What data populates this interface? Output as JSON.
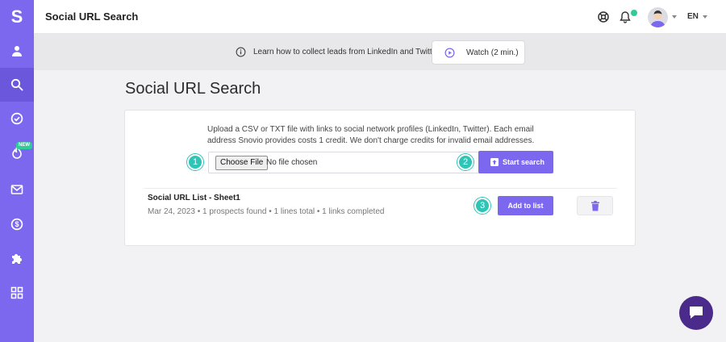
{
  "app": {
    "logo_letter": "S",
    "title": "Social URL Search"
  },
  "sidebar": {
    "items": [
      {
        "icon": "user-icon"
      },
      {
        "icon": "search-icon",
        "active": true
      },
      {
        "icon": "check-circle-icon"
      },
      {
        "icon": "fire-icon",
        "badge": "NEW"
      },
      {
        "icon": "mail-icon"
      },
      {
        "icon": "dollar-icon"
      },
      {
        "icon": "puzzle-icon"
      },
      {
        "icon": "apps-grid-icon"
      }
    ]
  },
  "header": {
    "help_icon": "lifebuoy-icon",
    "notifications_icon": "bell-icon",
    "language": "EN"
  },
  "banner": {
    "text": "Learn how to collect leads from LinkedIn and Twitter",
    "watch_label": "Watch (2 min.)"
  },
  "page": {
    "title": "Social URL Search",
    "description": "Upload a CSV or TXT file with links to social network profiles (LinkedIn, Twitter). Each email address Snovio provides costs 1 credit. We don't charge credits for invalid email addresses.",
    "file_input": {
      "button": "Choose File",
      "status": "No file chosen"
    },
    "start_search_label": "Start search",
    "steps": [
      "1",
      "2",
      "3"
    ],
    "list": {
      "name": "Social URL List - Sheet1",
      "meta": "Mar 24, 2023 • 1 prospects found • 1 lines total • 1 links completed",
      "add_label": "Add to list"
    }
  },
  "colors": {
    "accent": "#7b68ee",
    "step": "#2ec4b6",
    "chat": "#4a2a8a"
  }
}
